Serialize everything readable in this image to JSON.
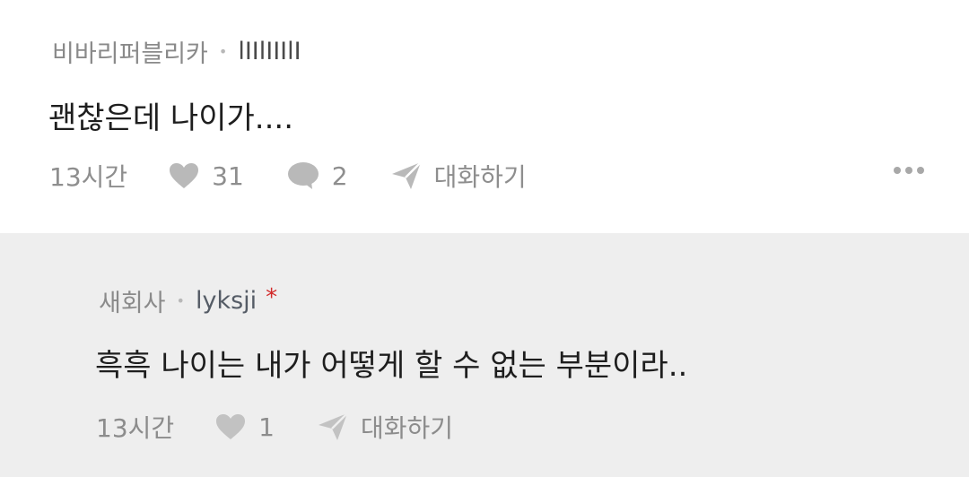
{
  "comments": [
    {
      "company": "비바리퍼블리카",
      "nickname": "lIIlIIIlI",
      "text": "괜찮은데 나이가....",
      "time": "13시간",
      "likes": "31",
      "replies": "2",
      "chat_label": "대화하기"
    },
    {
      "company": "새회사",
      "nickname": "lyksji",
      "author_mark": "*",
      "text": "흑흑 나이는 내가 어떻게 할 수 없는 부분이라..",
      "time": "13시간",
      "likes": "1",
      "chat_label": "대화하기"
    }
  ],
  "colors": {
    "reply_background": "#eeeeee",
    "muted_text": "#8a8a8a",
    "author_mark": "#d22a2a"
  }
}
